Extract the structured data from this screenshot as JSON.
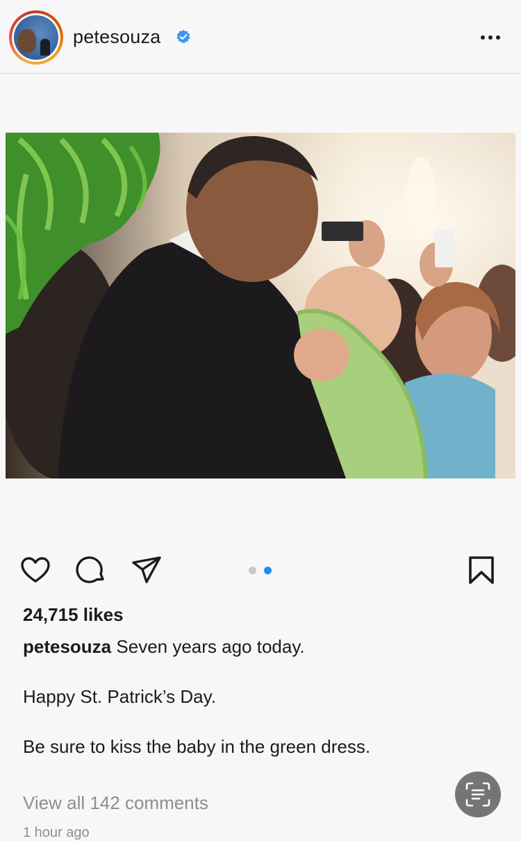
{
  "header": {
    "username": "petesouza",
    "verified_icon": "verified-badge-icon",
    "more_icon": "more-options-icon"
  },
  "post": {
    "image_description_icon": "photo",
    "carousel": {
      "count": 2,
      "active_index": 1
    },
    "actions": {
      "like_icon": "heart-icon",
      "comment_icon": "comment-bubble-icon",
      "share_icon": "paper-plane-icon",
      "save_icon": "bookmark-icon"
    },
    "likes_text": "24,715 likes",
    "caption": {
      "username": "petesouza",
      "line1": "Seven years ago today.",
      "line2": "Happy St. Patrick’s Day.",
      "line3": "Be sure to kiss the baby in the green dress."
    },
    "comments_link": "View all 142 comments",
    "timestamp": "1 hour ago"
  },
  "overlay": {
    "scan_icon": "text-scan-icon"
  },
  "colors": {
    "accent_blue": "#1d8bf0",
    "verified_blue": "#3897f0",
    "dot_inactive": "#c7c7c7",
    "muted_text": "#8e8e8e",
    "background": "#f7f7f8"
  }
}
